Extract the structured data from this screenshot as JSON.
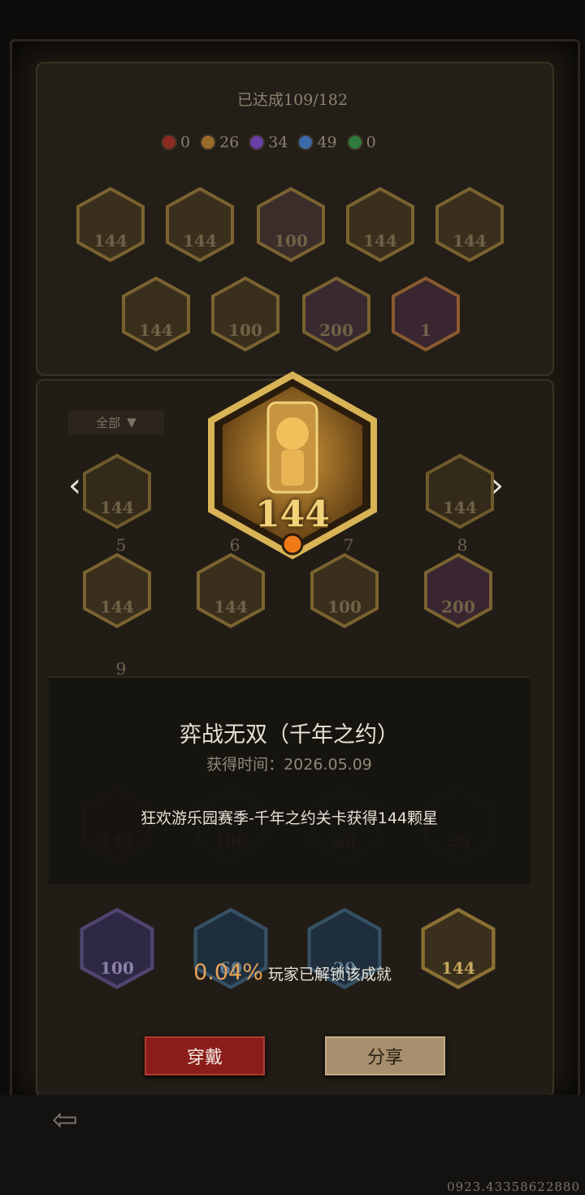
{
  "progress": {
    "label": "已达成109/182"
  },
  "gems": [
    {
      "color": "#8a2a20",
      "count": "0"
    },
    {
      "color": "#9a6a2a",
      "count": "26"
    },
    {
      "color": "#6a3fa6",
      "count": "34"
    },
    {
      "color": "#3c6aa8",
      "count": "49"
    },
    {
      "color": "#2f7a3a",
      "count": "0"
    }
  ],
  "top_badges": [
    {
      "num": "144",
      "icon": "creature-icon"
    },
    {
      "num": "144",
      "icon": "creature-icon"
    },
    {
      "num": "100",
      "icon": "crown-icon"
    },
    {
      "num": "144",
      "icon": "dragon-icon"
    },
    {
      "num": "144",
      "icon": "gourd-icon"
    },
    {
      "num": "144",
      "icon": "record-icon"
    },
    {
      "num": "100",
      "icon": "swords-icon"
    },
    {
      "num": "200",
      "icon": "trophy-icon"
    },
    {
      "num": "1",
      "icon": "trophy-icon"
    }
  ],
  "filter": {
    "label": "全部"
  },
  "nav": {
    "prev": "‹",
    "next": "›"
  },
  "grid_badges": [
    {
      "slot": "",
      "num": "144"
    },
    {
      "slot": "",
      "num": "144"
    },
    {
      "slot": "5",
      "num": "144"
    },
    {
      "slot": "6",
      "num": "144"
    },
    {
      "slot": "7",
      "num": "100"
    },
    {
      "slot": "8",
      "num": "200"
    },
    {
      "slot": "9",
      "num": ""
    },
    {
      "slot": "",
      "num": "144"
    },
    {
      "slot": "",
      "num": "100"
    },
    {
      "slot": "",
      "num": "60"
    },
    {
      "slot": "",
      "num": "20"
    },
    {
      "slot": "",
      "num": "100"
    },
    {
      "slot": "",
      "num": "60"
    },
    {
      "slot": "",
      "num": "20"
    },
    {
      "slot": "",
      "num": "144"
    }
  ],
  "hero": {
    "num": "144",
    "icon": "doll-on-throne-icon"
  },
  "detail": {
    "title": "弈战无双（千年之约）",
    "time": "获得时间：2026.05.09",
    "desc": "狂欢游乐园赛季-千年之约关卡获得144颗星"
  },
  "unlock": {
    "percent": "0.04%",
    "text": "玩家已解锁该成就"
  },
  "buttons": {
    "wear": "穿戴",
    "share": "分享"
  },
  "back": {
    "icon": "back-arrow-icon",
    "glyph": "⇦"
  },
  "serial": "0923.43358622880"
}
